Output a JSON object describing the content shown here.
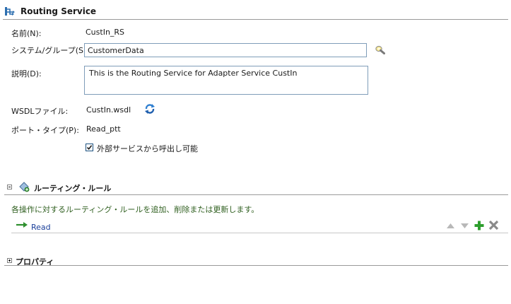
{
  "header": {
    "title": "Routing Service",
    "icon": "routing-service-icon"
  },
  "form": {
    "name_label": "名前(N):",
    "name_value": "CustIn_RS",
    "system_label": "システム/グループ(S):",
    "system_value": "CustomerData",
    "description_label": "説明(D):",
    "description_value": "This is the Routing Service for Adapter Service CustIn",
    "wsdl_label": "WSDLファイル:",
    "wsdl_value": "CustIn.wsdl",
    "port_label": "ポート・タイプ(P):",
    "port_value": "Read_ptt",
    "external_checkbox_label": "外部サービスから呼出し可能",
    "external_checked": true
  },
  "routing_section": {
    "title": "ルーティング・ルール",
    "expanded": true,
    "description": "各操作に対するルーティング・ルールを追加、削除または更新します。",
    "operations": [
      {
        "label": "Read"
      }
    ]
  },
  "properties_section": {
    "title": "プロパティ",
    "expanded": false
  },
  "colors": {
    "link": "#1a3f9a",
    "description_text": "#2f5f1f",
    "add_icon": "#2e9e2e",
    "field_border": "#7f9db9"
  }
}
